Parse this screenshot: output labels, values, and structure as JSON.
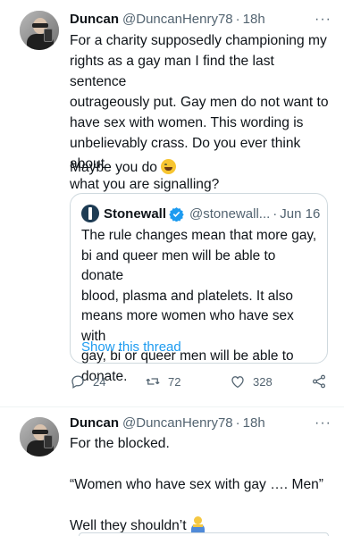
{
  "tweet1": {
    "name": "Duncan",
    "handle": "@DuncanHenry78",
    "separator": "·",
    "time": "18h",
    "more": "···",
    "text_lines": [
      "For a charity supposedly championing my",
      "rights as a gay man I find the last sentence",
      "outrageously put. Gay men do not want to",
      "have sex with women. This wording is",
      "unbelievably crass. Do you ever think about",
      "what you are signalling?"
    ],
    "text2": "Maybe you do",
    "quote": {
      "name": "Stonewall",
      "handle": "@stonewall...",
      "separator": "·",
      "date": "Jun 16",
      "text_lines": [
        "The rule changes mean that more gay,",
        "bi and queer men will be able to donate",
        "blood, plasma and platelets. It also",
        "means more women who have sex with",
        "gay, bi or queer men will be able to",
        "donate."
      ],
      "show_thread": "Show this thread"
    },
    "actions": {
      "replies": "24",
      "retweets": "72",
      "likes": "328"
    }
  },
  "tweet2": {
    "name": "Duncan",
    "handle": "@DuncanHenry78",
    "separator": "·",
    "time": "18h",
    "more": "···",
    "line1": "For the blocked.",
    "line2": "“Women who have sex with gay …. Men”",
    "line3": "Well they shouldn’t"
  },
  "colors": {
    "accent": "#1d9bf0",
    "secondary_text": "#536471",
    "border": "#cfd9de"
  },
  "icons": [
    "reply-icon",
    "retweet-icon",
    "like-icon",
    "share-icon",
    "verified-badge-icon",
    "more-icon"
  ]
}
